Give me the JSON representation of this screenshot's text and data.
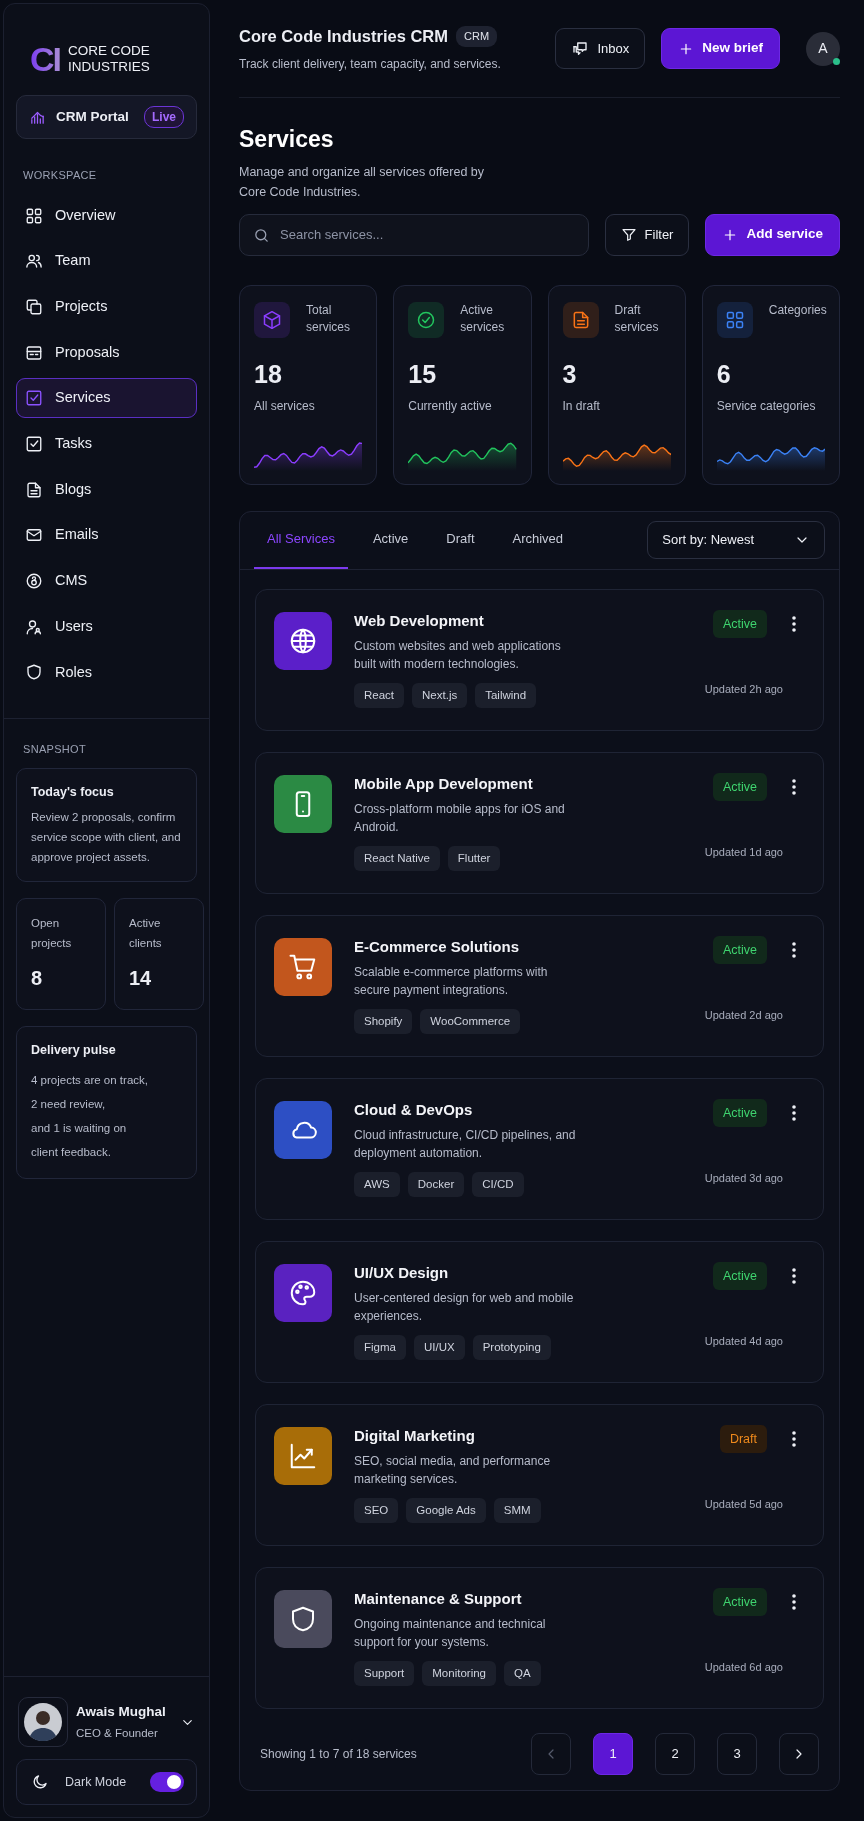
{
  "brand": {
    "logo": "CI",
    "name_lines": [
      "CORE CODE",
      "INDUSTRIES"
    ]
  },
  "portal": {
    "label": "CRM Portal",
    "badge": "Live"
  },
  "sidebar": {
    "section": "WORKSPACE",
    "items": [
      {
        "label": "Overview",
        "selected": false
      },
      {
        "label": "Team",
        "selected": false
      },
      {
        "label": "Projects",
        "selected": false
      },
      {
        "label": "Proposals",
        "selected": false
      },
      {
        "label": "Services",
        "selected": true
      },
      {
        "label": "Tasks",
        "selected": false
      },
      {
        "label": "Blogs",
        "selected": false
      },
      {
        "label": "Emails",
        "selected": false
      },
      {
        "label": "CMS",
        "selected": false
      },
      {
        "label": "Users",
        "selected": false
      },
      {
        "label": "Roles",
        "selected": false
      }
    ]
  },
  "snapshot": {
    "title": "SNAPSHOT",
    "focus": {
      "title": "Today's focus",
      "text": "Review 2 proposals, confirm service scope with client, and approve project assets."
    },
    "stats": [
      {
        "label": "Open projects",
        "value": "8"
      },
      {
        "label": "Active clients",
        "value": "14"
      }
    ],
    "pulse": {
      "title": "Delivery pulse",
      "lines": [
        "4 projects are on track,",
        "2 need review,",
        "and 1 is waiting on",
        "client feedback."
      ]
    }
  },
  "user": {
    "name": "Awais Mughal",
    "role": "CEO & Founder"
  },
  "theme": {
    "label": "Dark Mode",
    "on": true
  },
  "header": {
    "title": "Core Code Industries CRM",
    "badge": "CRM",
    "subtitle": "Track client delivery, team capacity, and services.",
    "buttons": [
      {
        "label": "Inbox",
        "kind": "outline"
      },
      {
        "label": "New brief",
        "kind": "primary"
      }
    ],
    "avatar": {
      "initial": "A",
      "online": true
    }
  },
  "page": {
    "title": "Services",
    "description": "Manage and organize all services offered by Core Code Industries."
  },
  "search": {
    "placeholder": "Search services..."
  },
  "filter": {
    "label": "Filter"
  },
  "add": {
    "label": "Add service"
  },
  "stats": [
    {
      "label": "Total services",
      "value": "18",
      "caption": "All services",
      "color": "#8b3dff"
    },
    {
      "label": "Active services",
      "value": "15",
      "caption": "Currently active",
      "color": "#22c55e"
    },
    {
      "label": "Draft services",
      "value": "3",
      "caption": "In draft",
      "color": "#f97316"
    },
    {
      "label": "Categories",
      "value": "6",
      "caption": "Service categories",
      "color": "#3b82f6"
    }
  ],
  "tabs": [
    {
      "label": "All Services",
      "selected": true
    },
    {
      "label": "Active",
      "selected": false
    },
    {
      "label": "Draft",
      "selected": false
    },
    {
      "label": "Archived",
      "selected": false
    }
  ],
  "sort": {
    "label": "Sort by: Newest"
  },
  "services": [
    {
      "name": "Web Development",
      "description": "Custom websites and web applications built with modern technologies.",
      "tags": [
        "React",
        "Next.js",
        "Tailwind"
      ],
      "status": {
        "label": "Active",
        "kind": "active"
      },
      "updated": "Updated 2h ago",
      "color": "#5b1fc9"
    },
    {
      "name": "Mobile App Development",
      "description": "Cross-platform mobile apps for iOS and Android.",
      "tags": [
        "React Native",
        "Flutter"
      ],
      "status": {
        "label": "Active",
        "kind": "active"
      },
      "updated": "Updated 1d ago",
      "color": "#2b8a44"
    },
    {
      "name": "E-Commerce Solutions",
      "description": "Scalable e-commerce platforms with secure payment integrations.",
      "tags": [
        "Shopify",
        "WooCommerce"
      ],
      "status": {
        "label": "Active",
        "kind": "active"
      },
      "updated": "Updated 2d ago",
      "color": "#c2561d"
    },
    {
      "name": "Cloud & DevOps",
      "description": "Cloud infrastructure, CI/CD pipelines, and deployment automation.",
      "tags": [
        "AWS",
        "Docker",
        "CI/CD"
      ],
      "status": {
        "label": "Active",
        "kind": "active"
      },
      "updated": "Updated 3d ago",
      "color": "#2d4fc4"
    },
    {
      "name": "UI/UX Design",
      "description": "User-centered design for web and mobile experiences.",
      "tags": [
        "Figma",
        "UI/UX",
        "Prototyping"
      ],
      "status": {
        "label": "Active",
        "kind": "active"
      },
      "updated": "Updated 4d ago",
      "color": "#5a22c0"
    },
    {
      "name": "Digital Marketing",
      "description": "SEO, social media, and performance marketing services.",
      "tags": [
        "SEO",
        "Google Ads",
        "SMM"
      ],
      "status": {
        "label": "Draft",
        "kind": "draft"
      },
      "updated": "Updated 5d ago",
      "color": "#a86d08"
    },
    {
      "name": "Maintenance & Support",
      "description": "Ongoing maintenance and technical support for your systems.",
      "tags": [
        "Support",
        "Monitoring",
        "QA"
      ],
      "status": {
        "label": "Active",
        "kind": "active"
      },
      "updated": "Updated 6d ago",
      "color": "#4a4a5c"
    }
  ],
  "pagination": {
    "summary": "Showing 1 to 7 of 18 services",
    "prev_disabled": true,
    "next_disabled": false,
    "pages": [
      {
        "label": "1",
        "selected": true
      },
      {
        "label": "2",
        "selected": false
      },
      {
        "label": "3",
        "selected": false
      }
    ]
  }
}
